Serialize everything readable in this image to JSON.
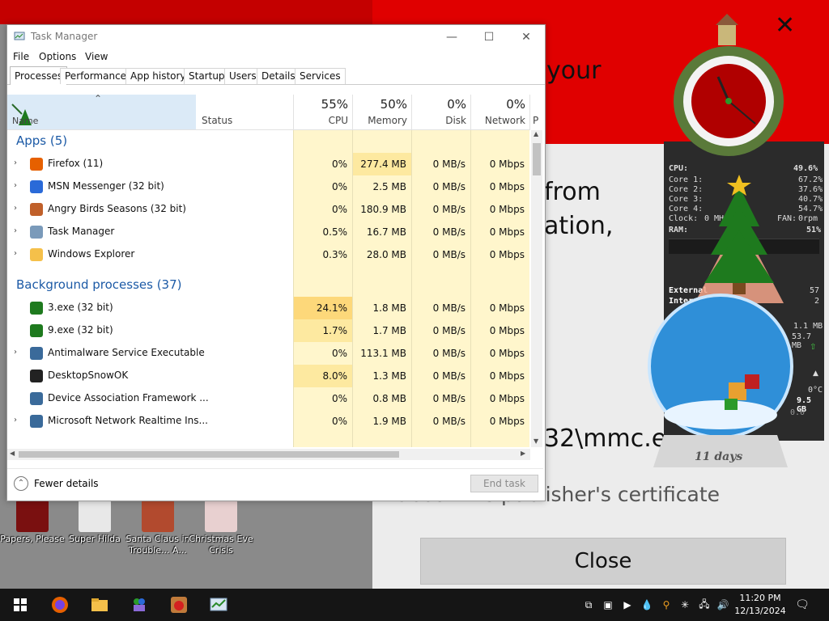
{
  "background_window": {
    "texts": [
      "your",
      "from",
      "ation,",
      "32\\mmc.ex",
      "about the publisher's certificate"
    ],
    "close_button": "Close",
    "close_x": "✕"
  },
  "gadgets": {
    "cpu_meter": {
      "cpu_label": "CPU:",
      "cpu_value": "49.6%",
      "cores": [
        {
          "label": "Core 1:",
          "value": "67.2%"
        },
        {
          "label": "Core 2:",
          "value": "37.6%"
        },
        {
          "label": "Core 3:",
          "value": "40.7%"
        },
        {
          "label": "Core 4:",
          "value": "54.7%"
        }
      ],
      "clock_label": "Clock:",
      "clock_value": "0 MHz",
      "fan_label": "FAN:",
      "fan_value": "0rpm",
      "ram_label": "RAM:",
      "ram_value": "51%"
    },
    "network": {
      "external_label": "External",
      "external_value": "57",
      "internal_label": "Internal",
      "internal_value": "2",
      "rate1": "1.1 MB",
      "rate2": "53.7 MB"
    },
    "weather": {
      "temp": "0°C",
      "size": "9.5 GB",
      "extra": "0.0"
    },
    "snow_globe_caption": "11 days"
  },
  "task_manager": {
    "title": "Task Manager",
    "menu": [
      "File",
      "Options",
      "View"
    ],
    "tabs": [
      "Processes",
      "Performance",
      "App history",
      "Startup",
      "Users",
      "Details",
      "Services"
    ],
    "columns": {
      "name": "Name",
      "status": "Status",
      "cpu": {
        "pct": "55%",
        "label": "CPU"
      },
      "memory": {
        "pct": "50%",
        "label": "Memory"
      },
      "disk": {
        "pct": "0%",
        "label": "Disk"
      },
      "network": {
        "pct": "0%",
        "label": "Network"
      },
      "power": "P"
    },
    "apps_group": "Apps (5)",
    "apps": [
      {
        "name": "Firefox (11)",
        "cpu": "0%",
        "memory": "277.4 MB",
        "disk": "0 MB/s",
        "network": "0 Mbps",
        "icon": "firefox-icon"
      },
      {
        "name": "MSN Messenger (32 bit)",
        "cpu": "0%",
        "memory": "2.5 MB",
        "disk": "0 MB/s",
        "network": "0 Mbps",
        "icon": "msn-messenger-icon"
      },
      {
        "name": "Angry Birds Seasons (32 bit)",
        "cpu": "0%",
        "memory": "180.9 MB",
        "disk": "0 MB/s",
        "network": "0 Mbps",
        "icon": "angry-birds-icon"
      },
      {
        "name": "Task Manager",
        "cpu": "0.5%",
        "memory": "16.7 MB",
        "disk": "0 MB/s",
        "network": "0 Mbps",
        "icon": "task-manager-icon"
      },
      {
        "name": "Windows Explorer",
        "cpu": "0.3%",
        "memory": "28.0 MB",
        "disk": "0 MB/s",
        "network": "0 Mbps",
        "icon": "folder-icon"
      }
    ],
    "bg_group": "Background processes (37)",
    "background": [
      {
        "name": "3.exe (32 bit)",
        "cpu": "24.1%",
        "memory": "1.8 MB",
        "disk": "0 MB/s",
        "network": "0 Mbps",
        "expandable": false,
        "icon": "christmas-tree-icon"
      },
      {
        "name": "9.exe (32 bit)",
        "cpu": "1.7%",
        "memory": "1.7 MB",
        "disk": "0 MB/s",
        "network": "0 Mbps",
        "expandable": false,
        "icon": "christmas-tree-icon"
      },
      {
        "name": "Antimalware Service Executable",
        "cpu": "0%",
        "memory": "113.1 MB",
        "disk": "0 MB/s",
        "network": "0 Mbps",
        "expandable": true,
        "icon": "service-icon"
      },
      {
        "name": "DesktopSnowOK",
        "cpu": "8.0%",
        "memory": "1.3 MB",
        "disk": "0 MB/s",
        "network": "0 Mbps",
        "expandable": false,
        "icon": "snowflake-icon"
      },
      {
        "name": "Device Association Framework ...",
        "cpu": "0%",
        "memory": "0.8 MB",
        "disk": "0 MB/s",
        "network": "0 Mbps",
        "expandable": false,
        "icon": "service-icon"
      },
      {
        "name": "Microsoft Network Realtime Ins...",
        "cpu": "0%",
        "memory": "1.9 MB",
        "disk": "0 MB/s",
        "network": "0 Mbps",
        "expandable": true,
        "icon": "service-icon"
      }
    ],
    "fewer_details": "Fewer details",
    "end_task": "End task"
  },
  "desktop_icons": [
    {
      "label": "Papers, Please",
      "color": "#7a1010"
    },
    {
      "label": "Super Hilda",
      "color": "#e8e8e8"
    },
    {
      "label": "Santa Claus in Trouble... A...",
      "color": "#b24a2e"
    },
    {
      "label": "Christmas Eve Crisis",
      "color": "#e8d0d0"
    }
  ],
  "taskbar": {
    "time": "11:20 PM",
    "date": "12/13/2024",
    "pinned": [
      "windows-start-icon",
      "firefox-icon",
      "file-explorer-icon",
      "msn-messenger-icon",
      "angry-birds-icon",
      "task-manager-icon"
    ],
    "tray": [
      "window-icon",
      "display-icon",
      "media-icon",
      "drop-icon",
      "search-icon",
      "snowflake-icon",
      "network-icon",
      "volume-icon",
      "keyboard-icon"
    ]
  },
  "colors": {
    "cpu_heat_high": "#fdd87a",
    "cpu_heat_mid": "#fef3c2",
    "cell_bg": "#fff6cc",
    "group_blue": "#1c5aa6",
    "taskbar": "#151515"
  }
}
